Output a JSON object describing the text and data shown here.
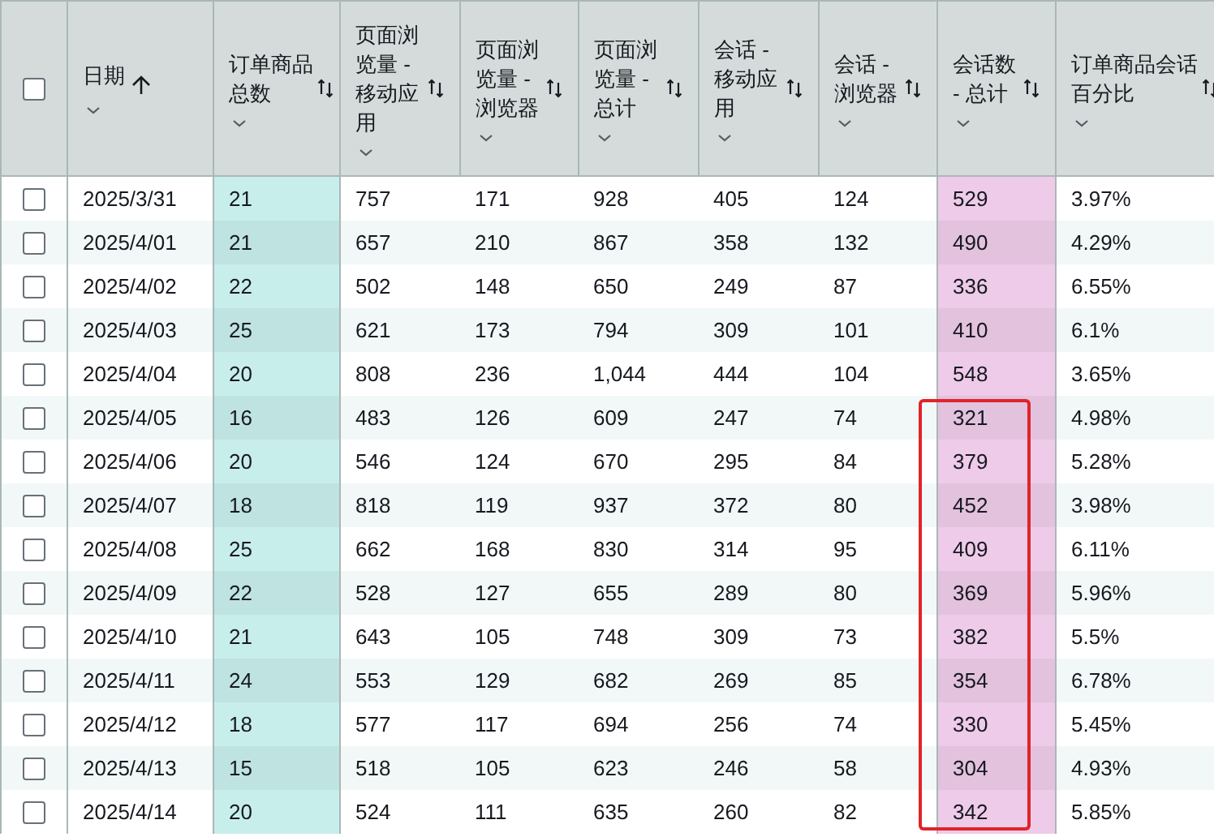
{
  "table": {
    "columns": [
      {
        "label": "日期",
        "sorted": true
      },
      {
        "label": "订单商品总数",
        "sorted": false,
        "color": "#c8eeeb"
      },
      {
        "label": "页面浏览量 - 移动应用",
        "sorted": false
      },
      {
        "label": "页面浏览量 - 浏览器",
        "sorted": false
      },
      {
        "label": "页面浏览量 - 总计",
        "sorted": false
      },
      {
        "label": "会话 - 移动应用",
        "sorted": false
      },
      {
        "label": "会话 - 浏览器",
        "sorted": false
      },
      {
        "label": "会话数 - 总计",
        "sorted": false,
        "color": "#eecbe9"
      },
      {
        "label": "订单商品会话百分比",
        "sorted": false
      }
    ],
    "select_all_checked": false,
    "rows": [
      {
        "checked": false,
        "marked": false,
        "cells": [
          "2025/3/31",
          "21",
          "757",
          "171",
          "928",
          "405",
          "124",
          "529",
          "3.97%"
        ]
      },
      {
        "checked": false,
        "marked": false,
        "cells": [
          "2025/4/01",
          "21",
          "657",
          "210",
          "867",
          "358",
          "132",
          "490",
          "4.29%"
        ]
      },
      {
        "checked": false,
        "marked": false,
        "cells": [
          "2025/4/02",
          "22",
          "502",
          "148",
          "650",
          "249",
          "87",
          "336",
          "6.55%"
        ]
      },
      {
        "checked": false,
        "marked": false,
        "cells": [
          "2025/4/03",
          "25",
          "621",
          "173",
          "794",
          "309",
          "101",
          "410",
          "6.1%"
        ]
      },
      {
        "checked": false,
        "marked": false,
        "cells": [
          "2025/4/04",
          "20",
          "808",
          "236",
          "1,044",
          "444",
          "104",
          "548",
          "3.65%"
        ]
      },
      {
        "checked": false,
        "marked": true,
        "cells": [
          "2025/4/05",
          "16",
          "483",
          "126",
          "609",
          "247",
          "74",
          "321",
          "4.98%"
        ]
      },
      {
        "checked": false,
        "marked": true,
        "cells": [
          "2025/4/06",
          "20",
          "546",
          "124",
          "670",
          "295",
          "84",
          "379",
          "5.28%"
        ]
      },
      {
        "checked": false,
        "marked": true,
        "cells": [
          "2025/4/07",
          "18",
          "818",
          "119",
          "937",
          "372",
          "80",
          "452",
          "3.98%"
        ]
      },
      {
        "checked": false,
        "marked": true,
        "cells": [
          "2025/4/08",
          "25",
          "662",
          "168",
          "830",
          "314",
          "95",
          "409",
          "6.11%"
        ]
      },
      {
        "checked": false,
        "marked": true,
        "cells": [
          "2025/4/09",
          "22",
          "528",
          "127",
          "655",
          "289",
          "80",
          "369",
          "5.96%"
        ]
      },
      {
        "checked": false,
        "marked": true,
        "cells": [
          "2025/4/10",
          "21",
          "643",
          "105",
          "748",
          "309",
          "73",
          "382",
          "5.5%"
        ]
      },
      {
        "checked": false,
        "marked": true,
        "cells": [
          "2025/4/11",
          "24",
          "553",
          "129",
          "682",
          "269",
          "85",
          "354",
          "6.78%"
        ]
      },
      {
        "checked": false,
        "marked": true,
        "cells": [
          "2025/4/12",
          "18",
          "577",
          "117",
          "694",
          "256",
          "74",
          "330",
          "5.45%"
        ]
      },
      {
        "checked": false,
        "marked": true,
        "cells": [
          "2025/4/13",
          "15",
          "518",
          "105",
          "623",
          "246",
          "58",
          "304",
          "4.93%"
        ]
      },
      {
        "checked": false,
        "marked": true,
        "cells": [
          "2025/4/14",
          "20",
          "524",
          "111",
          "635",
          "260",
          "82",
          "342",
          "5.85%"
        ]
      }
    ]
  }
}
